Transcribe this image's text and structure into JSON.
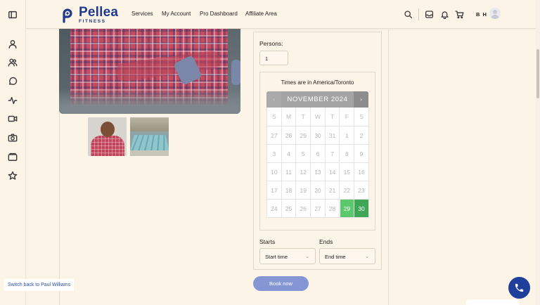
{
  "brand": {
    "name": "Pellea",
    "sub": "FITNESS",
    "color": "#1f3a8a"
  },
  "nav": {
    "items": [
      "Services",
      "My Account",
      "Pro Dashboard",
      "Affiliate Area"
    ]
  },
  "header": {
    "initials": "B H"
  },
  "sidebar": {
    "icons": [
      "panel-toggle-icon",
      "user-icon",
      "users-icon",
      "chat-icon",
      "activity-icon",
      "video-icon",
      "camera-icon",
      "wallet-icon",
      "star-icon"
    ]
  },
  "booking": {
    "persons_label": "Persons:",
    "persons_value": "1",
    "timezone_text": "Times are in America/Toronto",
    "calendar": {
      "prev": "‹",
      "next": "›",
      "month": "NOVEMBER 2024",
      "weekdays": [
        "S",
        "M",
        "T",
        "W",
        "T",
        "F",
        "S"
      ],
      "weeks": [
        [
          "27",
          "28",
          "29",
          "30",
          "31",
          "1",
          "2"
        ],
        [
          "3",
          "4",
          "5",
          "6",
          "7",
          "8",
          "9"
        ],
        [
          "10",
          "11",
          "12",
          "13",
          "14",
          "15",
          "16"
        ],
        [
          "17",
          "18",
          "19",
          "20",
          "21",
          "22",
          "23"
        ],
        [
          "24",
          "25",
          "26",
          "27",
          "28",
          "29",
          "30"
        ]
      ],
      "available_color": "#5cc86e",
      "selected_color": "#3fa656"
    },
    "starts_label": "Starts",
    "ends_label": "Ends",
    "start_placeholder": "Start time",
    "end_placeholder": "End time",
    "book_button": "Book now",
    "book_color": "#8596d4"
  },
  "switch_back": "Switch back to Paul Williams",
  "phone_color": "#1f3f9a"
}
